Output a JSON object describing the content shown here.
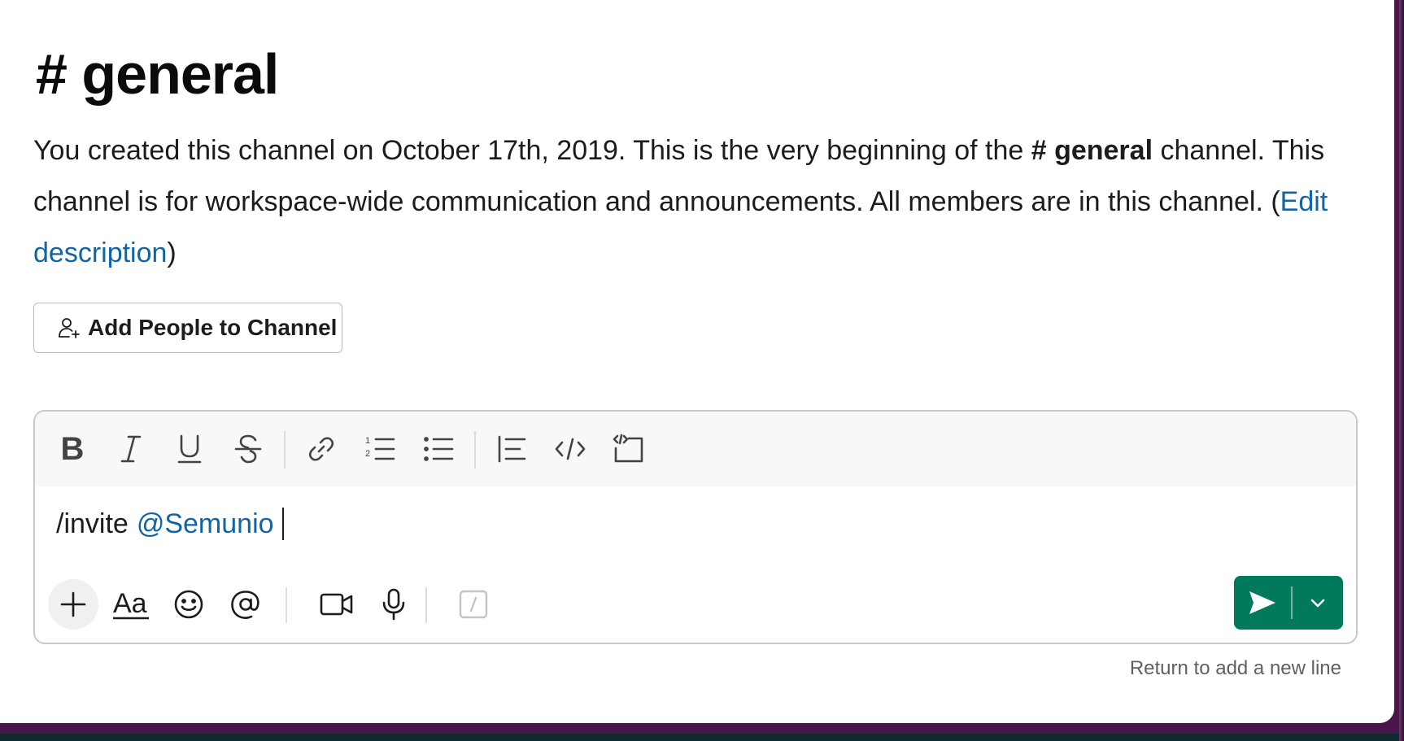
{
  "channel": {
    "title": "# general"
  },
  "intro": {
    "part1": "You created this channel on October 17th, 2019. This is the very beginning of the ",
    "channel_ref": "# general",
    "part2": " channel. This channel is for workspace-wide communication and announcements. All members are in this channel. (",
    "edit_link": "Edit description",
    "part3": ")"
  },
  "add_people": {
    "label": "Add People to Channel",
    "icon": "person-add-icon"
  },
  "composer": {
    "toolbar_icons": [
      "bold-icon",
      "italic-icon",
      "underline-icon",
      "strikethrough-icon",
      "link-icon",
      "ordered-list-icon",
      "bulleted-list-icon",
      "blockquote-icon",
      "code-icon",
      "code-block-icon"
    ],
    "message": {
      "command": "/invite",
      "mention": "@Semunio"
    },
    "bottom_icons": [
      "plus-icon",
      "formatting-aa-icon",
      "emoji-icon",
      "mention-at-icon",
      "video-icon",
      "microphone-icon",
      "slash-shortcuts-icon"
    ],
    "send_icon": "send-icon",
    "send_options_icon": "chevron-down-icon",
    "hint": "Return to add a new line"
  },
  "colors": {
    "accent_green": "#007a5a",
    "link_blue": "#1264a3",
    "frame_purple": "#4a154b"
  }
}
